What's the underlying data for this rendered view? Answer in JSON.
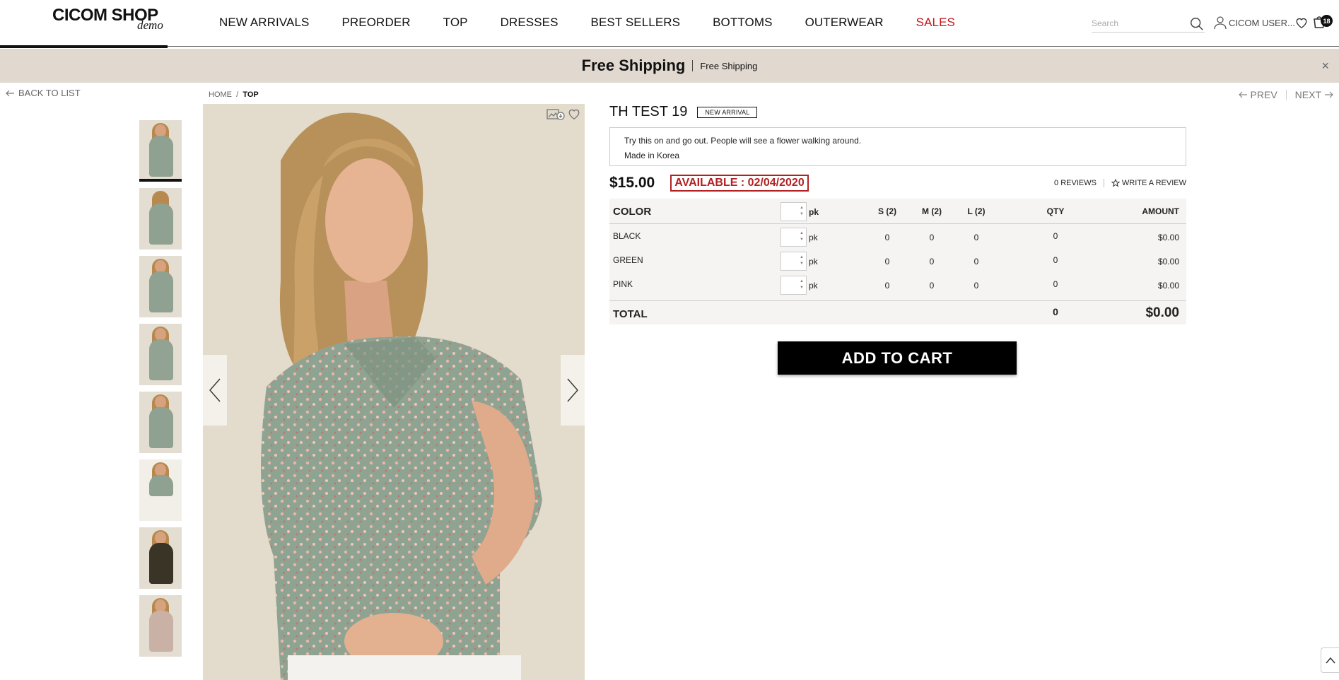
{
  "brand": {
    "logo": "CICOM SHOP",
    "logo_sub": "demo"
  },
  "nav": [
    {
      "label": "NEW ARRIVALS"
    },
    {
      "label": "PREORDER"
    },
    {
      "label": "TOP"
    },
    {
      "label": "DRESSES"
    },
    {
      "label": "BEST SELLERS"
    },
    {
      "label": "BOTTOMS"
    },
    {
      "label": "OUTERWEAR"
    },
    {
      "label": "SALES",
      "highlight": "#c4161c"
    }
  ],
  "search": {
    "placeholder": "Search"
  },
  "user": {
    "label": "CICOM USER..."
  },
  "cart": {
    "count": "18"
  },
  "promo": {
    "title": "Free Shipping",
    "subtitle": "Free Shipping",
    "close": "×"
  },
  "subnav": {
    "back": "BACK TO LIST",
    "prev": "PREV",
    "next": "NEXT"
  },
  "breadcrumb": {
    "home": "HOME",
    "sep": "/",
    "current": "TOP"
  },
  "product": {
    "title": "TH TEST 19",
    "badge": "NEW ARRIVAL",
    "description": [
      "Try this on and go out. People will see a flower walking around.",
      "Made in Korea"
    ],
    "price": "$15.00",
    "available": "AVAILABLE : 02/04/2020",
    "reviews": "0 REVIEWS",
    "write_review": "WRITE A REVIEW",
    "thumbnails": 8
  },
  "order_table": {
    "headers": {
      "color": "COLOR",
      "pack": "pk",
      "s": "S (2)",
      "m": "M (2)",
      "l": "L (2)",
      "qty": "QTY",
      "amount": "AMOUNT"
    },
    "rows": [
      {
        "color": "BLACK",
        "pack": "pk",
        "s": "0",
        "m": "0",
        "l": "0",
        "qty": "0",
        "amount": "$0.00"
      },
      {
        "color": "GREEN",
        "pack": "pk",
        "s": "0",
        "m": "0",
        "l": "0",
        "qty": "0",
        "amount": "$0.00"
      },
      {
        "color": "PINK",
        "pack": "pk",
        "s": "0",
        "m": "0",
        "l": "0",
        "qty": "0",
        "amount": "$0.00"
      }
    ],
    "total": {
      "label": "TOTAL",
      "qty": "0",
      "amount": "$0.00"
    }
  },
  "add_to_cart": "ADD TO CART",
  "colors": {
    "accent": "#c4161c",
    "promo_bg": "#e1d9d0",
    "button_bg": "#000000"
  }
}
